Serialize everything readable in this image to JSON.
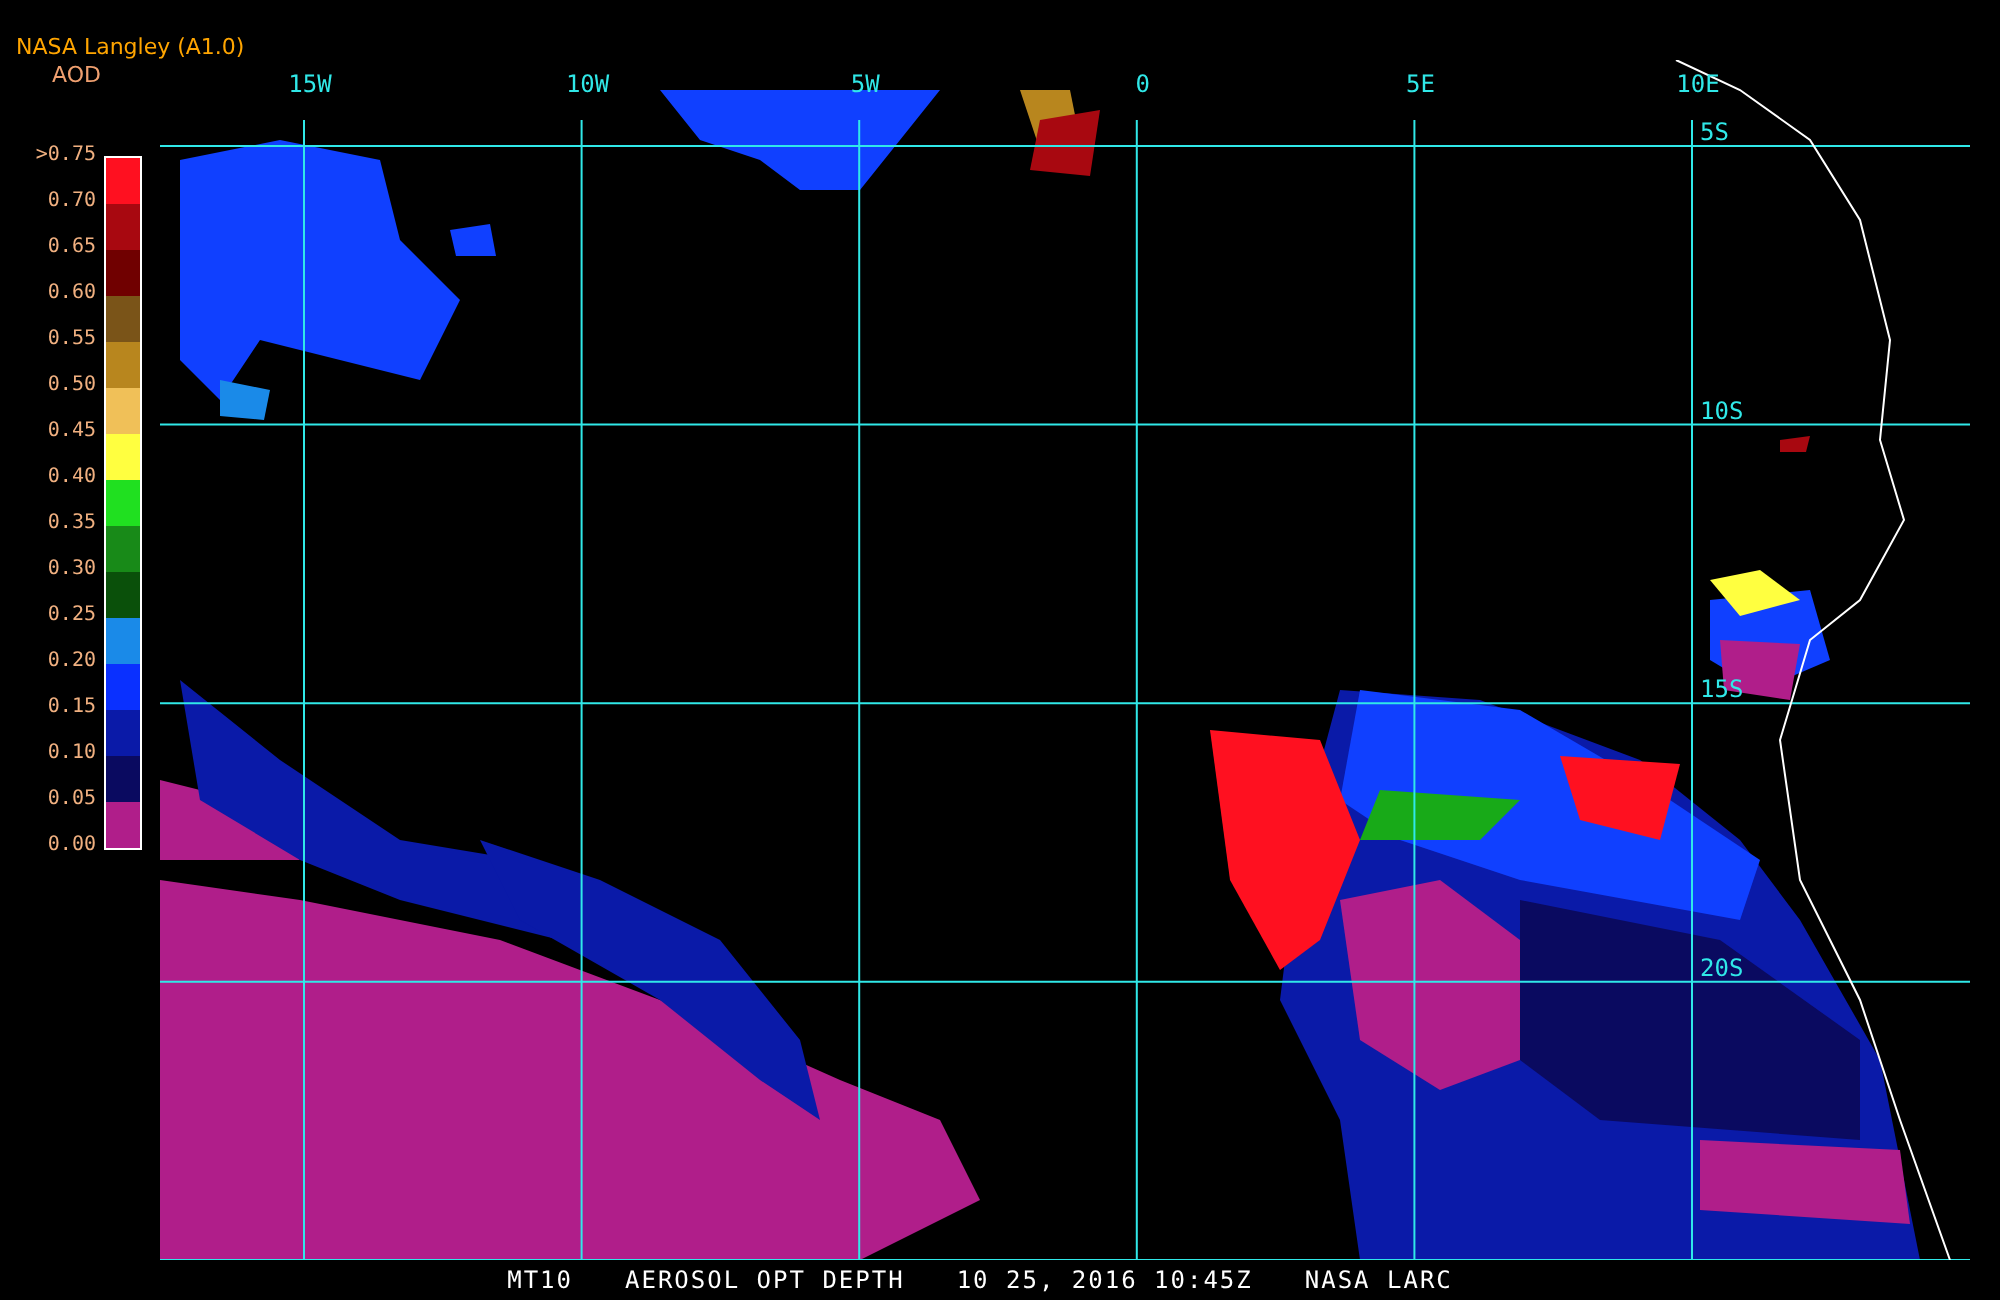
{
  "header": {
    "title": "NASA Langley (A1.0)",
    "subtitle": "AOD"
  },
  "legend": {
    "labels": [
      ">0.75",
      "0.70",
      "0.65",
      "0.60",
      "0.55",
      "0.50",
      "0.45",
      "0.40",
      "0.35",
      "0.30",
      "0.25",
      "0.20",
      "0.15",
      "0.10",
      "0.05",
      "0.00"
    ],
    "bins": [
      {
        "color": "#ff1020"
      },
      {
        "color": "#a80810"
      },
      {
        "color": "#700000"
      },
      {
        "color": "#7a5418"
      },
      {
        "color": "#b8861e"
      },
      {
        "color": "#f0c058"
      },
      {
        "color": "#ffff40"
      },
      {
        "color": "#20e020"
      },
      {
        "color": "#188a18"
      },
      {
        "color": "#0a500a"
      },
      {
        "color": "#1a8ae8"
      },
      {
        "color": "#0a30ff"
      },
      {
        "color": "#0a1aa8"
      },
      {
        "color": "#0a0a60"
      },
      {
        "color": "#b01e8a"
      }
    ]
  },
  "map": {
    "longitude_labels": [
      "15W",
      "10W",
      "5W",
      "0",
      "5E",
      "10E"
    ],
    "latitude_labels": [
      "5S",
      "10S",
      "15S",
      "20S"
    ]
  },
  "caption": [
    "MT10",
    "AEROSOL OPT DEPTH",
    "10 25, 2016 10:45Z",
    "NASA LARC"
  ]
}
